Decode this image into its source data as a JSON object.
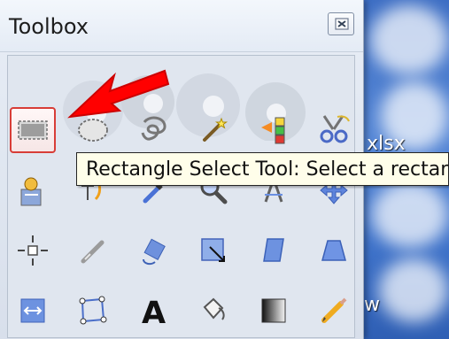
{
  "window": {
    "title": "Toolbox",
    "close_icon": "close-icon"
  },
  "desktop": {
    "label_1": "xlsx",
    "label_2": "w"
  },
  "tooltip": {
    "text": "Rectangle Select Tool: Select a rectangu"
  },
  "tools": [
    {
      "name": "rectangle-select",
      "selected": true
    },
    {
      "name": "ellipse-select",
      "selected": false
    },
    {
      "name": "free-select",
      "selected": false
    },
    {
      "name": "fuzzy-select",
      "selected": false
    },
    {
      "name": "select-by-color",
      "selected": false
    },
    {
      "name": "scissors-select",
      "selected": false
    },
    {
      "name": "foreground-select",
      "selected": false
    },
    {
      "name": "paths",
      "selected": false
    },
    {
      "name": "color-picker",
      "selected": false
    },
    {
      "name": "zoom",
      "selected": false
    },
    {
      "name": "measure",
      "selected": false
    },
    {
      "name": "move",
      "selected": false
    },
    {
      "name": "alignment",
      "selected": false
    },
    {
      "name": "crop",
      "selected": false
    },
    {
      "name": "rotate",
      "selected": false
    },
    {
      "name": "scale",
      "selected": false
    },
    {
      "name": "shear",
      "selected": false
    },
    {
      "name": "perspective",
      "selected": false
    },
    {
      "name": "flip",
      "selected": false
    },
    {
      "name": "cage-transform",
      "selected": false
    },
    {
      "name": "text",
      "selected": false
    },
    {
      "name": "bucket-fill",
      "selected": false
    },
    {
      "name": "blend",
      "selected": false
    },
    {
      "name": "pencil",
      "selected": false
    }
  ],
  "colors": {
    "highlight_red": "#ff0000",
    "tooltip_bg": "#fffeea",
    "desktop_blue": "#4a7cd0"
  }
}
